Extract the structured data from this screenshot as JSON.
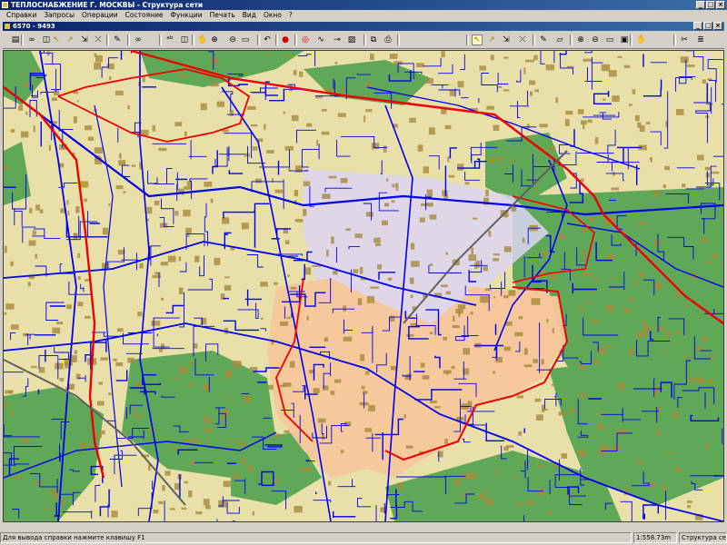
{
  "window": {
    "title": "ТЕПЛОСНАБЖЕНИЕ Г. МОСКВЫ - Структура сети"
  },
  "menu": [
    "Справки",
    "Запросы",
    "Операции",
    "Состояние",
    "Функции",
    "Печать",
    "Вид",
    "Окно",
    "?"
  ],
  "document": {
    "title": "6570 - 9493"
  },
  "toolbar": {
    "icons": [
      "open-icon",
      "binoculars-icon",
      "layer-icon",
      "select-pointer-icon",
      "select-arrow-icon",
      "select-group-icon",
      "delete-select-icon",
      "pencil-icon",
      "binoculars-icon",
      "spell-icon",
      "layer-icon",
      "hand-icon",
      "zoom-in-icon",
      "zoom-out-icon",
      "zoom-window-icon",
      "undo-icon",
      "traffic-light-icon",
      "target-icon",
      "pipe-icon",
      "pipe-node-icon",
      "picture-icon",
      "copy-icon",
      "print-icon",
      "select-pointer-icon",
      "select-arrow-icon",
      "select-group-icon",
      "delete-select-icon",
      "pencil-icon",
      "eraser-icon",
      "zoom-in-icon",
      "zoom-out-icon",
      "zoom-window-icon",
      "zoom-all-icon",
      "hand-icon",
      "cut-icon",
      "layers-icon"
    ]
  },
  "map": {
    "colors": {
      "background": "#e9dfa9",
      "parks": "#5fa858",
      "buildings": "#a68a3c",
      "network": "#0000ee",
      "boundary": "#ee0000",
      "highlight": "#f6c79a",
      "plot": "#ddd6f3"
    },
    "label": "6570 - 9493"
  },
  "status": {
    "hint": "Для вывода справки нажмите клавишу F1",
    "scale": "1:558.73m",
    "mode": "Структура сети"
  }
}
